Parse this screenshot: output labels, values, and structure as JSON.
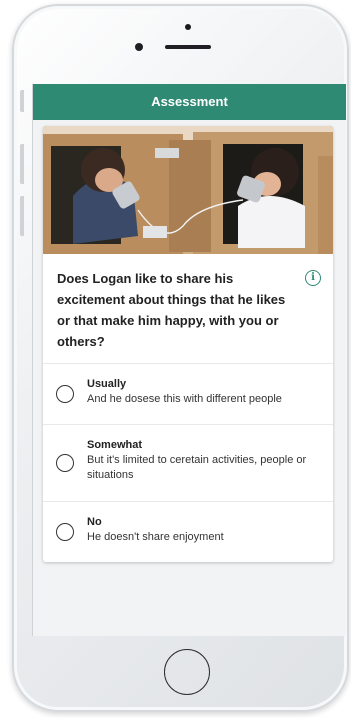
{
  "app": {
    "header_title": "Assessment"
  },
  "assessment": {
    "photo_alt": "Two children playing with tin can telephones in cardboard boxes",
    "question": "Does Logan like to share his excitement about things that he likes or that make him happy, with you or others?",
    "info_icon": "i",
    "options": [
      {
        "title": "Usually",
        "description": "And he dosese this with different people"
      },
      {
        "title": "Somewhat",
        "description": "But it's limited to ceretain activities, people or situations"
      },
      {
        "title": "No",
        "description": "He doesn't share enjoyment"
      }
    ]
  },
  "colors": {
    "accent": "#2f8a73",
    "background": "#f2f3f5",
    "card": "#ffffff"
  }
}
